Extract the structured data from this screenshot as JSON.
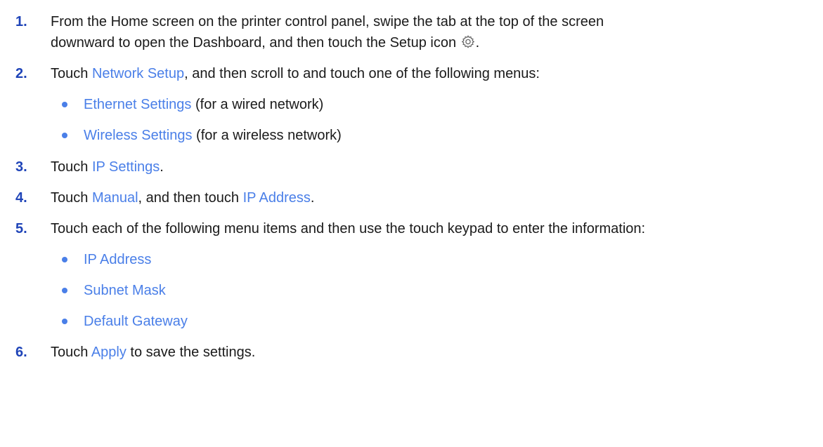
{
  "steps": [
    {
      "number": "1.",
      "line1": "From the Home screen on the printer control panel, swipe the tab at the top of the screen",
      "line2_pre": "downward to open the Dashboard, and then touch the Setup icon",
      "line2_post": ".",
      "icon": "gear-icon"
    },
    {
      "number": "2.",
      "pre": "Touch ",
      "link1": "Network Setup",
      "post": ", and then scroll to and touch one of the following menus:",
      "bullets": [
        {
          "link": "Ethernet Settings",
          "suffix": " (for a wired network)"
        },
        {
          "link": "Wireless Settings",
          "suffix": " (for a wireless network)"
        }
      ]
    },
    {
      "number": "3.",
      "pre": "Touch ",
      "link1": "IP Settings",
      "post": "."
    },
    {
      "number": "4.",
      "pre": "Touch ",
      "link1": "Manual",
      "mid": ", and then touch ",
      "link2": "IP Address",
      "post": "."
    },
    {
      "number": "5.",
      "text": "Touch each of the following menu items and then use the touch keypad to enter the information:",
      "bullets": [
        {
          "link": "IP Address"
        },
        {
          "link": "Subnet Mask"
        },
        {
          "link": "Default Gateway"
        }
      ]
    },
    {
      "number": "6.",
      "pre": "Touch ",
      "link1": "Apply",
      "post": " to save the settings."
    }
  ],
  "colors": {
    "number": "#1f44b8",
    "link": "#4a7fe8",
    "text": "#1a1a1a"
  }
}
